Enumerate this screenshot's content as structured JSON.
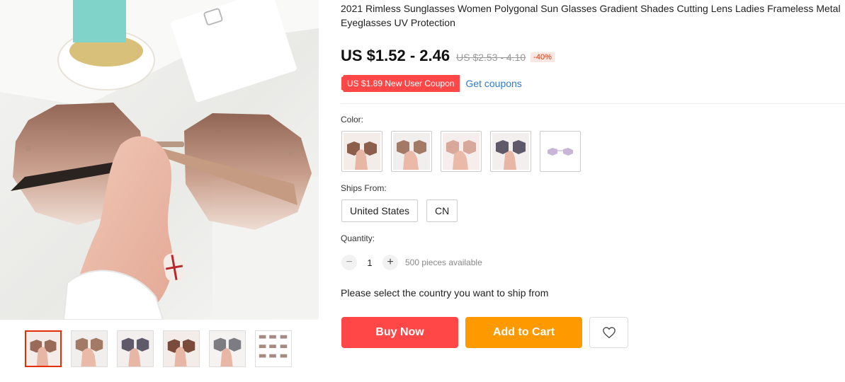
{
  "product": {
    "title": "2021 Rimless Sunglasses Women Polygonal Sun Glasses Gradient Shades Cutting Lens Ladies Frameless Metal Eyeglasses UV Protection",
    "price": "US $1.52 - 2.46",
    "original_price": "US $2.53 - 4.10",
    "discount": "-40%"
  },
  "coupon": {
    "badge": "US $1.89 New User Coupon",
    "link": "Get coupons"
  },
  "options": {
    "color_label": "Color:",
    "colors": [
      "tea-brown-icon",
      "brown-icon",
      "pink-icon",
      "gray-icon",
      "purple-icon"
    ],
    "ships_from_label": "Ships From:",
    "ships_from": [
      "United States",
      "CN"
    ]
  },
  "quantity": {
    "label": "Quantity:",
    "value": "1",
    "minus": "−",
    "plus": "+",
    "available": "500 pieces available"
  },
  "messages": {
    "ship_prompt": "Please select the country you want to ship from"
  },
  "actions": {
    "buy_now": "Buy Now",
    "add_to_cart": "Add to Cart",
    "wishlist_icon": "heart-icon"
  },
  "gallery": {
    "thumbnails": [
      "sunglasses-thumbnail-1",
      "sunglasses-thumbnail-2",
      "sunglasses-thumbnail-3",
      "sunglasses-thumbnail-4",
      "sunglasses-thumbnail-5",
      "sunglasses-thumbnail-6"
    ],
    "active_index": 0
  },
  "colors": {
    "accent": "#ff4747",
    "cart": "#ff9900",
    "link": "#2e7bd6",
    "active_border": "#e62e04"
  }
}
